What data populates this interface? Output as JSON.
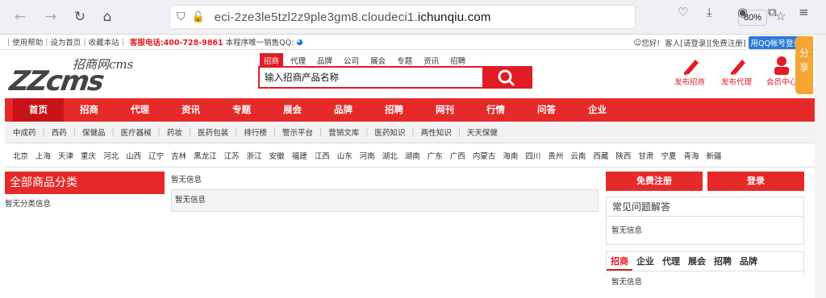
{
  "browser": {
    "url_prefix": "eci-2ze3le5tzl2z9ple3gm8.cloudeci1.",
    "url_domain": "ichunqiu.com",
    "zoom": "80%"
  },
  "topbar": {
    "links": [
      "使用帮助",
      "设为首页",
      "收藏本站"
    ],
    "tel": "客服电话:400-728-9861",
    "note": "本程序唯一销售QQ:",
    "greet": "您好!",
    "guest": "客人",
    "login": "[请登录]",
    "register": "[免费注册]",
    "qq_login": "用QQ帐号登录"
  },
  "logo": {
    "sub": "招商网cms",
    "main": "ZZcms"
  },
  "search": {
    "tabs": [
      "招商",
      "代理",
      "品牌",
      "公司",
      "展会",
      "专题",
      "资讯",
      "招聘"
    ],
    "value": "输入招商产品名称"
  },
  "publish": {
    "p1": "发布招商",
    "p2": "发布代理",
    "p3": "会员中心"
  },
  "mainnav": [
    "首页",
    "招商",
    "代理",
    "资讯",
    "专题",
    "展会",
    "品牌",
    "招聘",
    "网刊",
    "行情",
    "问答",
    "企业"
  ],
  "subnav": [
    "中成药",
    "西药",
    "保健品",
    "医疗器械",
    "药妆",
    "医药包装",
    "排行榜",
    "警示平台",
    "营销文库",
    "医药知识",
    "两性知识",
    "天天保健"
  ],
  "areas": [
    "北京",
    "上海",
    "天津",
    "重庆",
    "河北",
    "山西",
    "辽宁",
    "吉林",
    "黑龙江",
    "江苏",
    "浙江",
    "安徽",
    "福建",
    "江西",
    "山东",
    "河南",
    "湖北",
    "湖南",
    "广东",
    "广西",
    "内蒙古",
    "海南",
    "四川",
    "贵州",
    "云南",
    "西藏",
    "陕西",
    "甘肃",
    "宁夏",
    "青海",
    "新疆"
  ],
  "category": {
    "title": "全部商品分类",
    "empty": "暂无分类信息"
  },
  "middle": {
    "top": "暂无信息",
    "box": "暂无信息"
  },
  "right": {
    "reg": "免费注册",
    "login": "登录",
    "faq_title": "常见问题解答",
    "faq_empty": "暂无信息",
    "tabs": [
      "招商",
      "企业",
      "代理",
      "展会",
      "招聘",
      "品牌"
    ],
    "tabs_empty": "暂无信息"
  },
  "share": [
    "分",
    "享"
  ]
}
